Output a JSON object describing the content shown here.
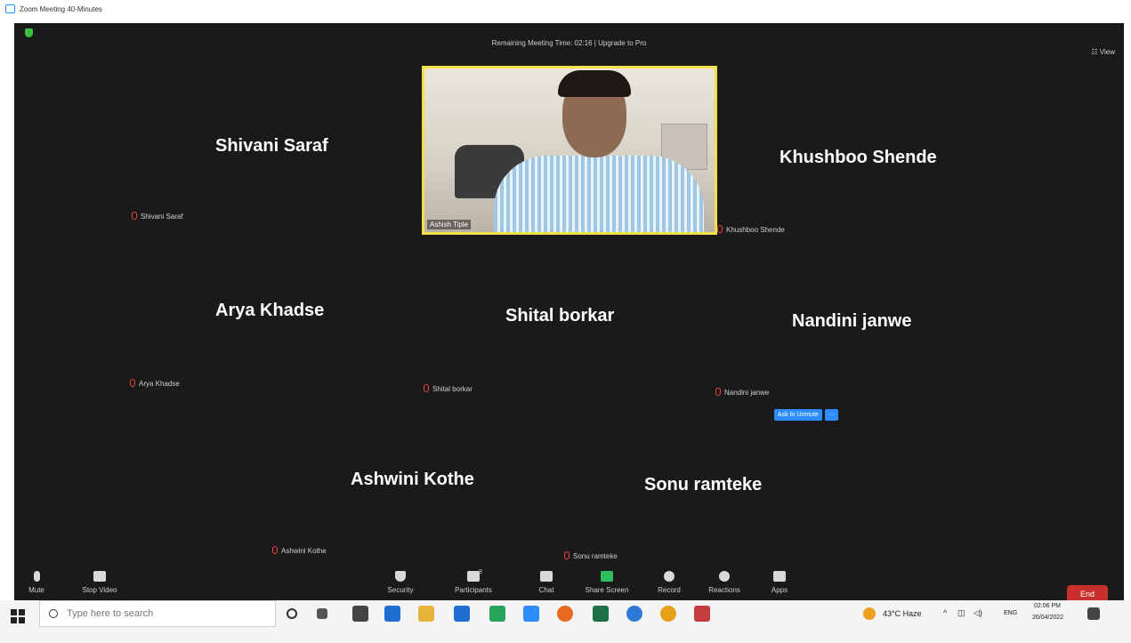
{
  "window": {
    "title": "Zoom Meeting 40-Minutes",
    "controls": {
      "minimize": "–",
      "restore": "⧉",
      "close": "×"
    }
  },
  "meeting": {
    "timer_text": "Remaining Meeting Time: 02:16 | Upgrade to Pro",
    "view_label": "☷ View",
    "video_participant": {
      "name": "Ashish Tiple"
    },
    "participants": [
      {
        "display": "Shivani Saraf",
        "label": "Shivani Saraf"
      },
      {
        "display": "Khushboo Shende",
        "label": "Khushboo Shende"
      },
      {
        "display": "Arya Khadse",
        "label": "Arya Khadse"
      },
      {
        "display": "Shital borkar",
        "label": "Shital borkar"
      },
      {
        "display": "Nandini janwe",
        "label": "Nandini janwe"
      },
      {
        "display": "Ashwini Kothe",
        "label": "Ashwini Kothe"
      },
      {
        "display": "Sonu ramteke",
        "label": "Sonu ramteke"
      }
    ],
    "ask_to_unmute": {
      "label": "Ask to Unmute",
      "more": "···"
    }
  },
  "toolbar": {
    "mute": "Mute",
    "stop_video": "Stop Video",
    "security": "Security",
    "participants": "Participants",
    "participants_count": "8",
    "chat": "Chat",
    "share_screen": "Share Screen",
    "record": "Record",
    "reactions": "Reactions",
    "apps": "Apps",
    "end": "End"
  },
  "taskbar": {
    "search_placeholder": "Type here to search",
    "weather": "43°C  Haze",
    "lang": "ENG",
    "time": "02:06 PM",
    "date": "26/04/2022"
  },
  "colors": {
    "meeting_bg": "#1a1a1a",
    "active_speaker_border": "#f2e04a",
    "end_button": "#c9302c",
    "unmute_button": "#2d8cff",
    "share_screen": "#2fbf60"
  }
}
